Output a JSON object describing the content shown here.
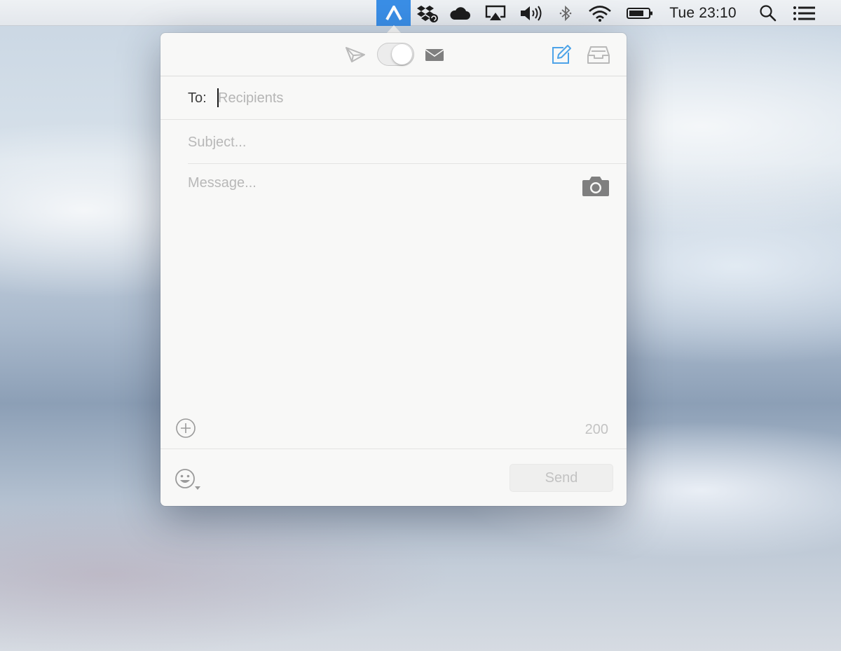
{
  "menubar": {
    "clock": "Tue 23:10",
    "icons": [
      "app-logo-icon",
      "dropbox-icon",
      "cloud-icon",
      "airplay-icon",
      "volume-icon",
      "bluetooth-icon",
      "wifi-icon",
      "battery-icon",
      "spotlight-search-icon",
      "notification-center-icon"
    ],
    "active_color": "#3a8ee6"
  },
  "composer": {
    "toolbar": {
      "left_icon": "paper-plane-icon",
      "right_icon": "envelope-icon",
      "compose_icon": "compose-icon",
      "inbox_icon": "inbox-tray-icon",
      "accent": "#4da3e8"
    },
    "to_label": "To:",
    "to_placeholder": "Recipients",
    "subject_placeholder": "Subject...",
    "message_placeholder": "Message...",
    "char_count": "200",
    "send_label": "Send"
  }
}
